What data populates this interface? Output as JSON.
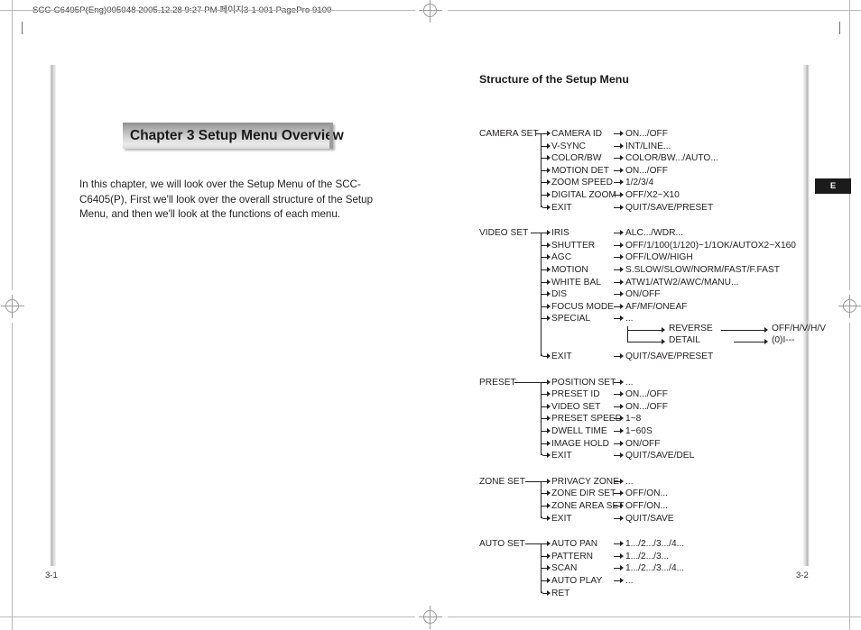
{
  "print_header": "SCC-C6405P(Eng)005048  2005.12.28 9:27 PM  페이지3-1   001 PagePro 9100",
  "left_page": {
    "chapter_banner": "Chapter 3  Setup Menu Overview",
    "intro": "In this chapter, we will look over the Setup Menu of the SCC-C6405(P), First we'll look over the overall structure of the Setup Menu, and then we'll look at the functions of each menu.",
    "folio": "3-1"
  },
  "right_page": {
    "section_title": "Structure of the Setup Menu",
    "edition_tab": "E",
    "folio": "3-2"
  },
  "menu_tree": [
    {
      "group": "CAMERA SET",
      "items": [
        {
          "name": "CAMERA ID",
          "value": "ON.../OFF"
        },
        {
          "name": "V-SYNC",
          "value": "INT/LINE..."
        },
        {
          "name": "COLOR/BW",
          "value": "COLOR/BW.../AUTO..."
        },
        {
          "name": "MOTION DET",
          "value": "ON.../OFF"
        },
        {
          "name": "ZOOM SPEED",
          "value": "1/2/3/4"
        },
        {
          "name": "DIGITAL ZOOM",
          "value": "OFF/X2~X10"
        },
        {
          "name": "EXIT",
          "value": "QUIT/SAVE/PRESET"
        }
      ]
    },
    {
      "group": "VIDEO SET",
      "items": [
        {
          "name": "IRIS",
          "value": "ALC.../WDR..."
        },
        {
          "name": "SHUTTER",
          "value": "OFF/1/100(1/120)~1/1OK/AUTOX2~X160"
        },
        {
          "name": "AGC",
          "value": "OFF/LOW/HIGH"
        },
        {
          "name": "MOTION",
          "value": "S.SLOW/SLOW/NORM/FAST/F.FAST"
        },
        {
          "name": "WHITE BAL",
          "value": "ATW1/ATW2/AWC/MANU..."
        },
        {
          "name": "DIS",
          "value": "ON/OFF"
        },
        {
          "name": "FOCUS MODE",
          "value": "AF/MF/ONEAF"
        },
        {
          "name": "SPECIAL",
          "value": "..."
        },
        {
          "name": "EXIT",
          "value": "QUIT/SAVE/PRESET"
        }
      ],
      "subtree_after_index": 7,
      "subtree": [
        {
          "name": "REVERSE",
          "value": "OFF/H/V/H/V"
        },
        {
          "name": "DETAIL",
          "value": "(0)I---"
        }
      ]
    },
    {
      "group": "PRESET",
      "items": [
        {
          "name": "POSITION SET",
          "value": "..."
        },
        {
          "name": "PRESET ID",
          "value": "ON.../OFF"
        },
        {
          "name": "VIDEO SET",
          "value": "ON.../OFF"
        },
        {
          "name": "PRESET SPEED",
          "value": "1~8"
        },
        {
          "name": "DWELL TIME",
          "value": "1~60S"
        },
        {
          "name": "IMAGE HOLD",
          "value": "ON/OFF"
        },
        {
          "name": "EXIT",
          "value": "QUIT/SAVE/DEL"
        }
      ]
    },
    {
      "group": "ZONE SET",
      "items": [
        {
          "name": "PRIVACY ZONE",
          "value": "..."
        },
        {
          "name": "ZONE DIR SET",
          "value": "OFF/ON..."
        },
        {
          "name": "ZONE AREA SET",
          "value": "OFF/ON..."
        },
        {
          "name": "EXIT",
          "value": "QUIT/SAVE"
        }
      ]
    },
    {
      "group": "AUTO SET",
      "items": [
        {
          "name": "AUTO PAN",
          "value": "1.../2.../3.../4..."
        },
        {
          "name": "PATTERN",
          "value": "1.../2.../3..."
        },
        {
          "name": "SCAN",
          "value": "1.../2.../3.../4..."
        },
        {
          "name": "AUTO PLAY",
          "value": "..."
        },
        {
          "name": "RET",
          "value": ""
        }
      ]
    }
  ]
}
